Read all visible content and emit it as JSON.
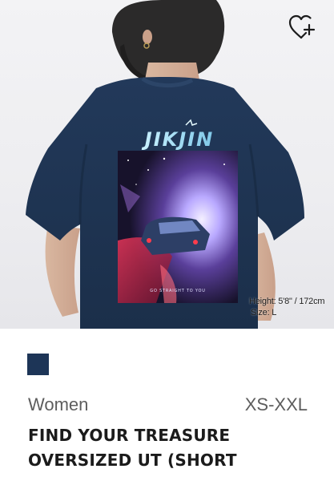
{
  "product": {
    "category": "Women",
    "size_range": "XS-XXL",
    "title_line1": "FIND YOUR TREASURE",
    "title_line2": "OVERSIZED UT (SHORT",
    "color_swatch": "#1d3557"
  },
  "image": {
    "model_height_label": "Height: 5'8\" / 172cm",
    "model_size_label": "Size: L",
    "graphic_text": "JIKJIN",
    "graphic_caption": "GO STRAIGHT TO YOU"
  },
  "icons": {
    "wishlist": "heart-plus-icon"
  },
  "colors": {
    "shirt": "#1f3652",
    "swatch": "#1d3557",
    "text_muted": "#5d5d5d",
    "text_strong": "#1b1b1b"
  }
}
